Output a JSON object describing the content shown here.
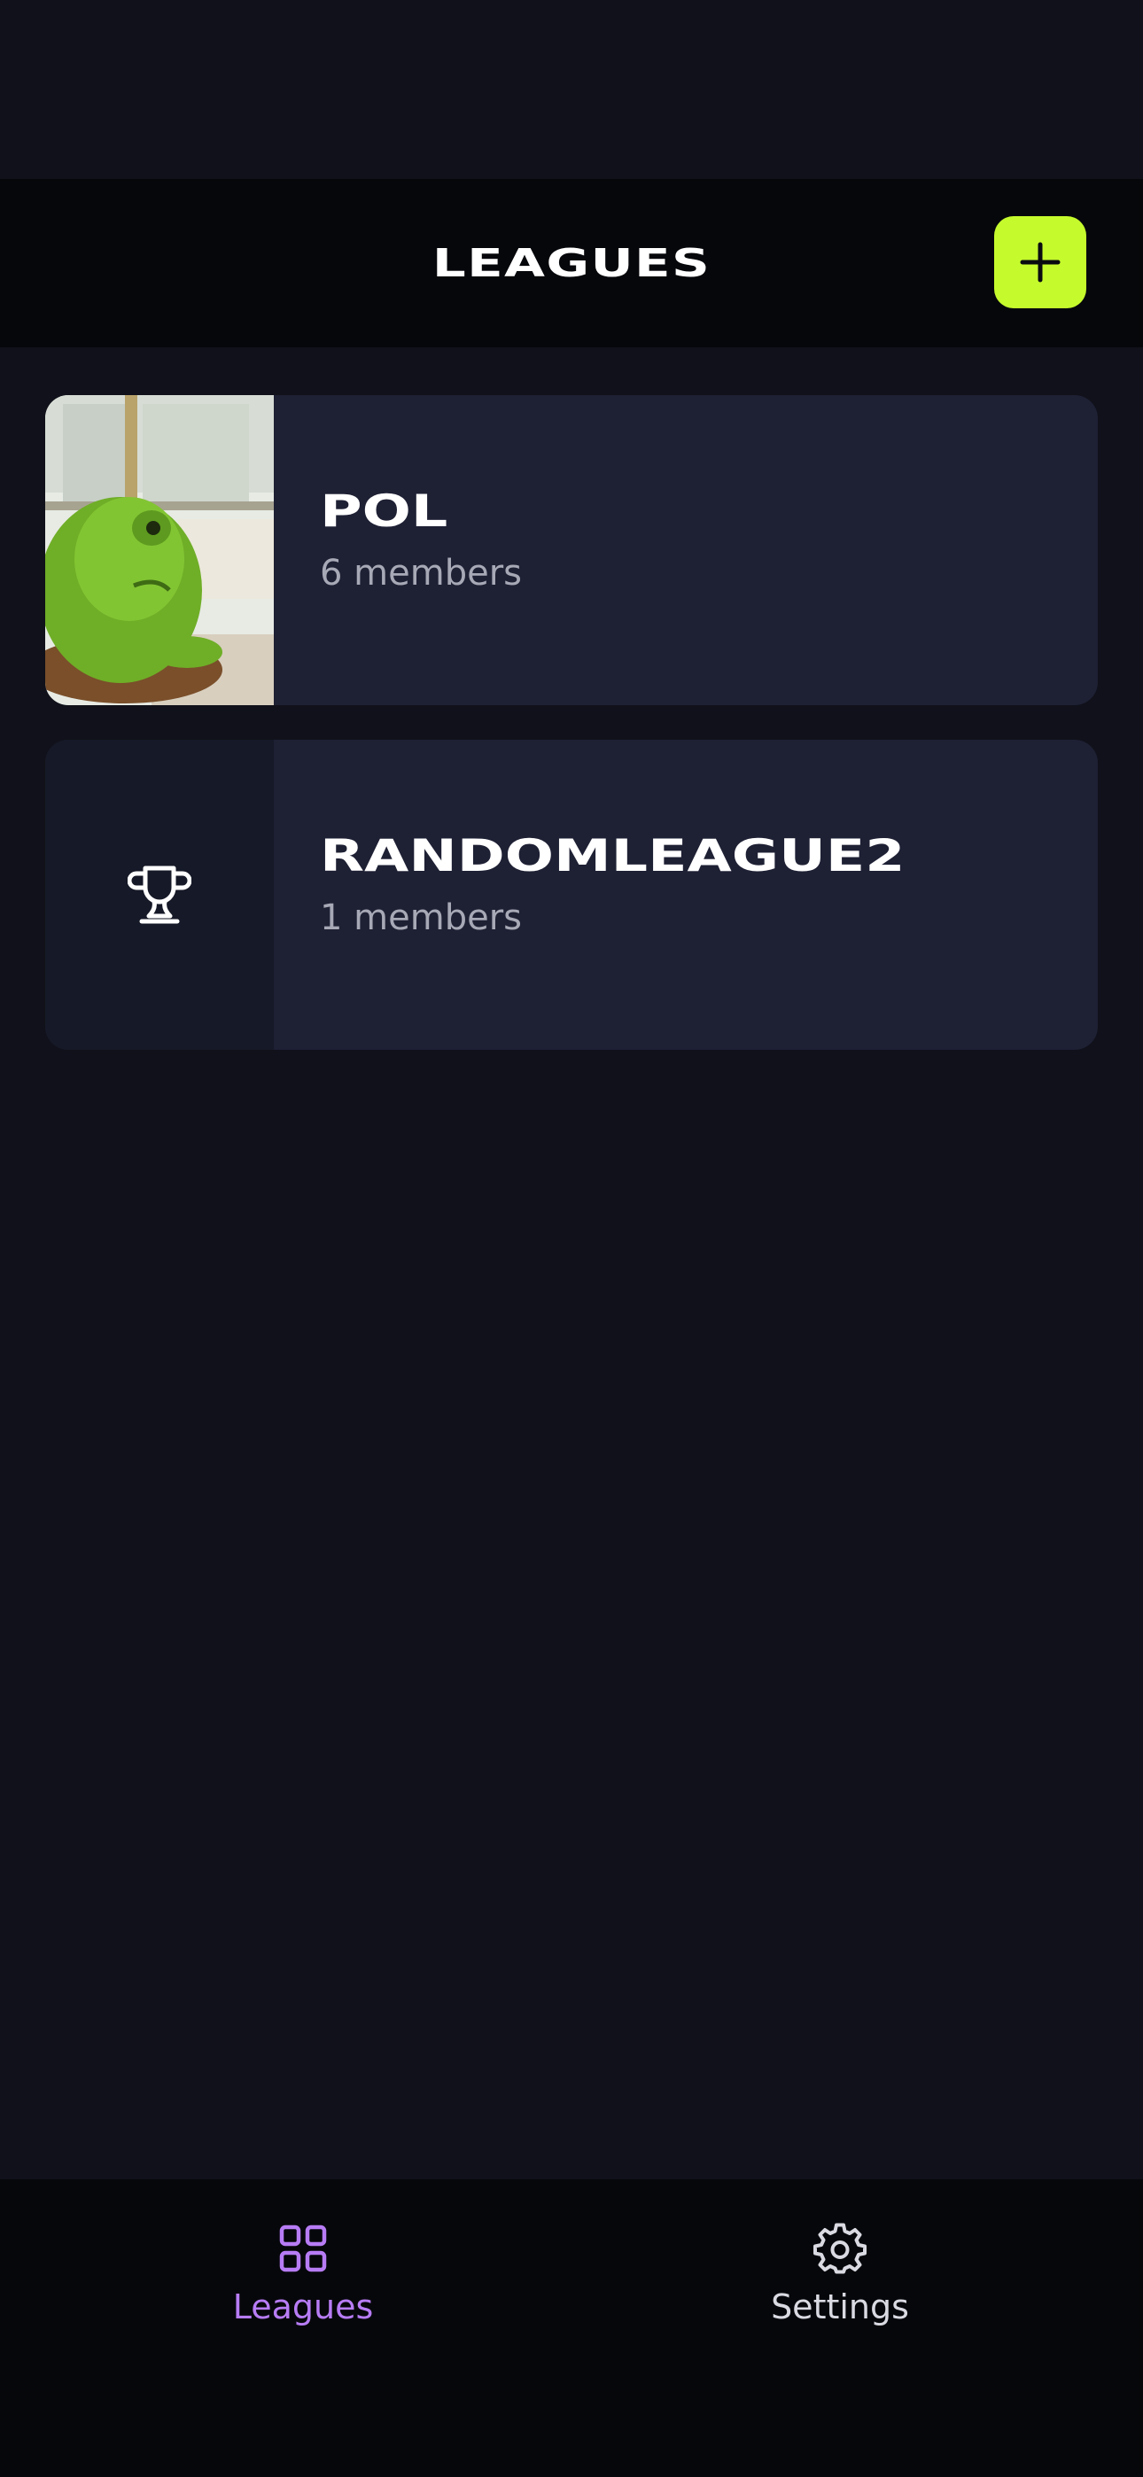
{
  "header": {
    "title": "LEAGUES",
    "add_icon": "plus-icon"
  },
  "leagues": [
    {
      "name": "POL",
      "members": "6 members",
      "thumbnail": "green-frog-photo"
    },
    {
      "name": "RANDOMLEAGUE2",
      "members": "1 members",
      "thumbnail": "trophy-icon"
    }
  ],
  "tabbar": {
    "tabs": [
      {
        "label": "Leagues",
        "icon": "grid-icon",
        "active": true
      },
      {
        "label": "Settings",
        "icon": "gear-icon",
        "active": false
      }
    ]
  },
  "colors": {
    "background": "#10111a",
    "header_bg": "#06070b",
    "card_bg": "#1e2034",
    "accent_lime": "#c5fb2c",
    "active_tab": "#b77cf5",
    "inactive_tab": "#d9dae2",
    "secondary_text": "#a7a9b6"
  }
}
